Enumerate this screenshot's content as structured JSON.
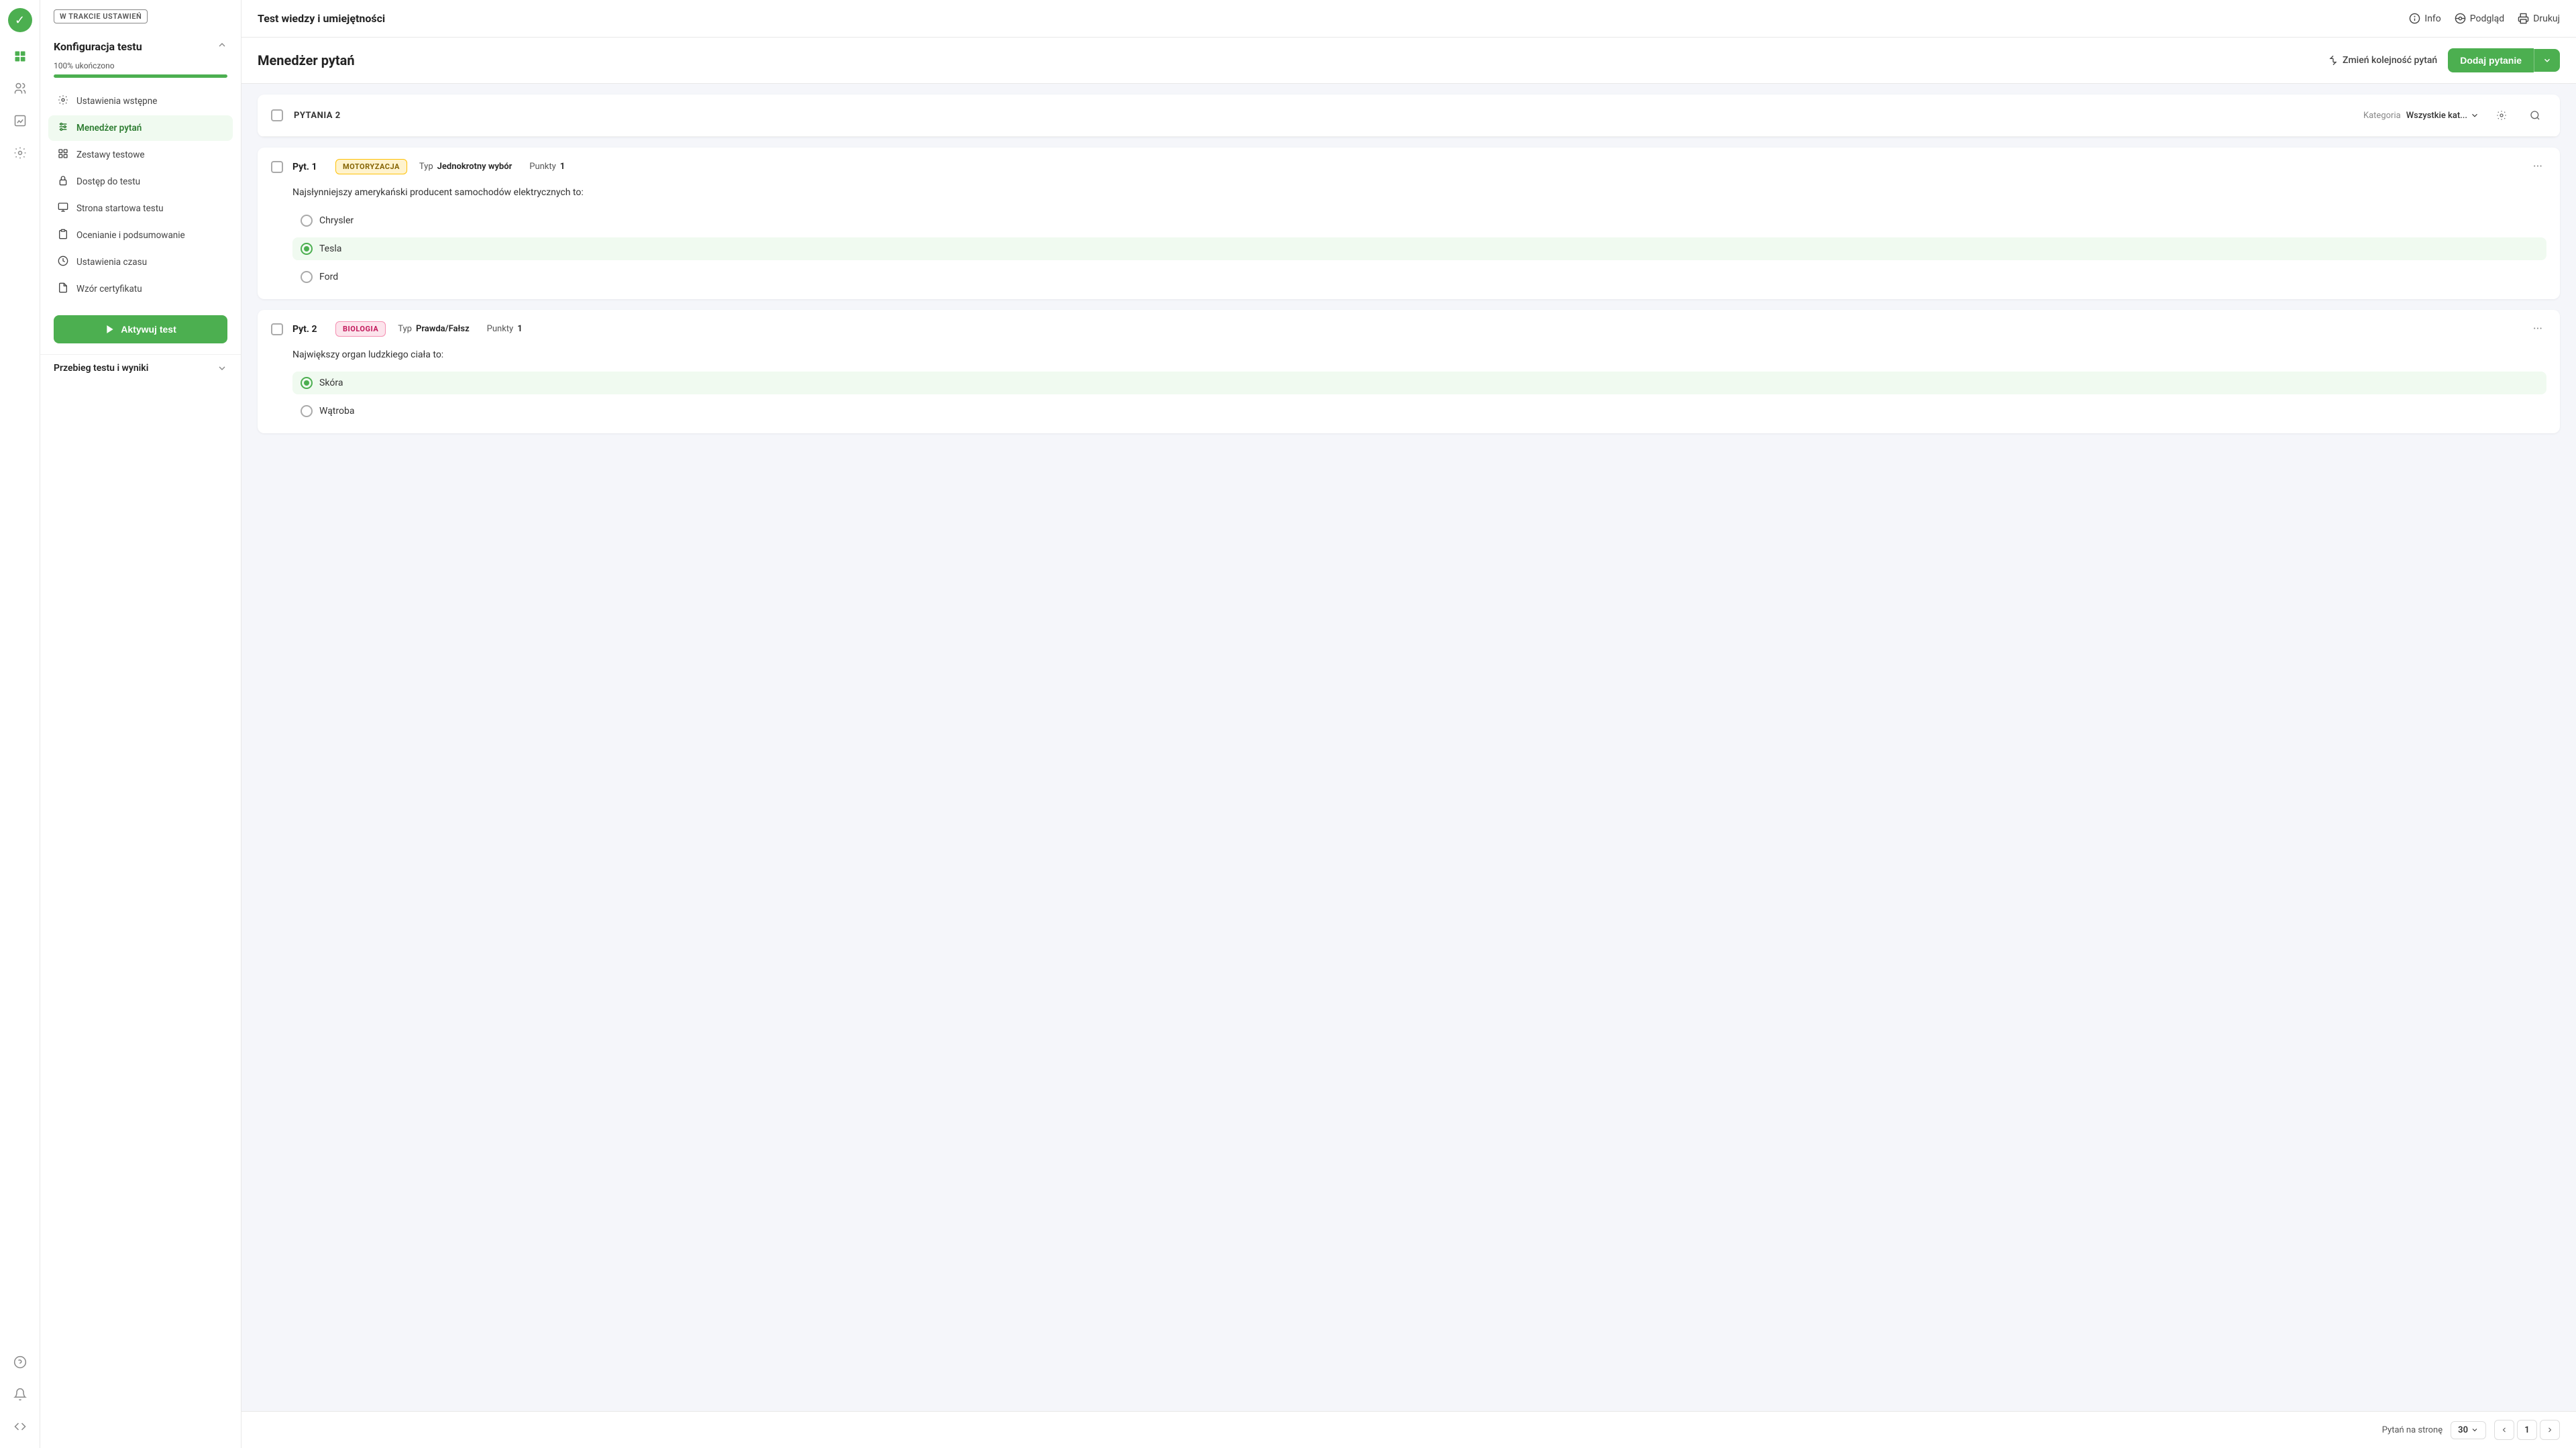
{
  "app": {
    "logo_symbol": "✓",
    "title": "Test wiedzy i umiejętności"
  },
  "topbar": {
    "info_label": "Info",
    "preview_label": "Podgląd",
    "print_label": "Drukuj"
  },
  "sidebar": {
    "status_badge": "W TRAKCIE USTAWIEŃ",
    "config_title": "Konfiguracja testu",
    "progress_label": "100% ukończono",
    "progress_percent": 100,
    "nav_items": [
      {
        "id": "settings",
        "icon": "⚙",
        "label": "Ustawienia wstępne"
      },
      {
        "id": "questions",
        "icon": "≡",
        "label": "Menedżer pytań",
        "active": true
      },
      {
        "id": "sets",
        "icon": "▦",
        "label": "Zestawy testowe"
      },
      {
        "id": "access",
        "icon": "🔒",
        "label": "Dostęp do testu"
      },
      {
        "id": "start",
        "icon": "🖥",
        "label": "Strona startowa testu"
      },
      {
        "id": "grading",
        "icon": "📋",
        "label": "Ocenianie i podsumowanie"
      },
      {
        "id": "time",
        "icon": "🕐",
        "label": "Ustawienia czasu"
      },
      {
        "id": "cert",
        "icon": "📄",
        "label": "Wzór certyfikatu"
      }
    ],
    "activate_btn": "Aktywuj test",
    "bottom_section_title": "Przebieg testu i wyniki"
  },
  "questions_manager": {
    "title": "Menedżer pytań",
    "reorder_label": "Zmień kolejność pytań",
    "add_question_label": "Dodaj pytanie",
    "questions_count_label": "PYTANIA 2",
    "category_label": "Kategoria",
    "category_value": "Wszystkie kat...",
    "questions": [
      {
        "id": "q1",
        "label": "Pyt. 1",
        "tag": "MOTORYZACJA",
        "tag_class": "tag-motoryzacja",
        "type_label": "Typ",
        "type_value": "Jednokrotny wybór",
        "points_label": "Punkty",
        "points_value": 1,
        "question_text": "Najsłynniejszy amerykański producent samochodów elektrycznych to:",
        "options": [
          {
            "text": "Chrysler",
            "correct": false,
            "selected": false
          },
          {
            "text": "Tesla",
            "correct": true,
            "selected": true
          },
          {
            "text": "Ford",
            "correct": false,
            "selected": false
          }
        ]
      },
      {
        "id": "q2",
        "label": "Pyt. 2",
        "tag": "BIOLOGIA",
        "tag_class": "tag-biologia",
        "type_label": "Typ",
        "type_value": "Prawda/Fałsz",
        "points_label": "Punkty",
        "points_value": 1,
        "question_text": "Największy organ ludzkiego ciała to:",
        "options": [
          {
            "text": "Skóra",
            "correct": true,
            "selected": true
          },
          {
            "text": "Wątroba",
            "correct": false,
            "selected": false
          }
        ]
      }
    ]
  },
  "pagination": {
    "per_page_label": "Pytań na stronę",
    "per_page_value": "30",
    "current_page": "1"
  }
}
